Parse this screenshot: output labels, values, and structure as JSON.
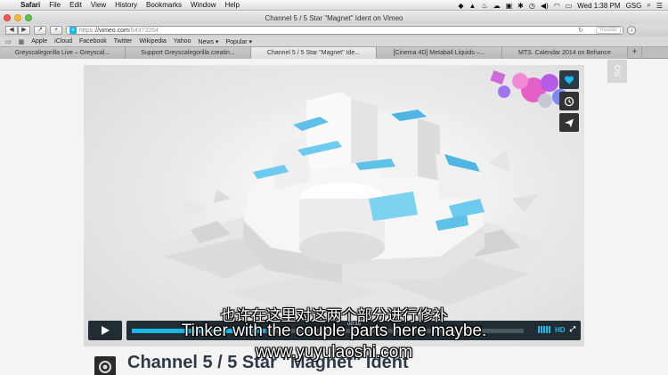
{
  "menubar": {
    "app": "Safari",
    "items": [
      "File",
      "Edit",
      "View",
      "History",
      "Bookmarks",
      "Window",
      "Help"
    ],
    "clock": "Wed 1:38 PM",
    "user": "GSG"
  },
  "window": {
    "title": "Channel 5 / 5 Star \"Magnet\" Ident on Vimeo"
  },
  "toolbar": {
    "back": "◀",
    "forward": "▶",
    "share": "↗",
    "add": "+",
    "url_scheme": "https",
    "url_host": "vimeo.com",
    "url_path": "/64373264",
    "reader": "Reader"
  },
  "bookmarks": [
    "Apple",
    "iCloud",
    "Facebook",
    "Twitter",
    "Wikipedia",
    "Yahoo",
    "News ▾",
    "Popular ▾"
  ],
  "tabs": [
    "Greyscalegorilla Live – Greyscal...",
    "Support Greyscalegorilla creatin...",
    "Channel 5 / 5 Star \"Magnet\" Ide...",
    "[Cinema 4D] Metaball Liquids –...",
    "MTS. Calendar 2014 on Behance"
  ],
  "active_tab": 2,
  "side_tab": "OS",
  "player": {
    "timecode": "00:16",
    "progress": 0.34,
    "hd": "HD"
  },
  "subtitles": {
    "chinese": "也许在这里对这两个部分进行修补",
    "english": "Tinker with the couple parts here maybe."
  },
  "watermark": "www.yuyulaoshi.com",
  "video": {
    "title": "Channel 5 / 5 Star \"Magnet\" Ident"
  },
  "colors": {
    "accent": "#1ab7ea",
    "player_bg": "#222c33",
    "title": "#2c3b47"
  }
}
